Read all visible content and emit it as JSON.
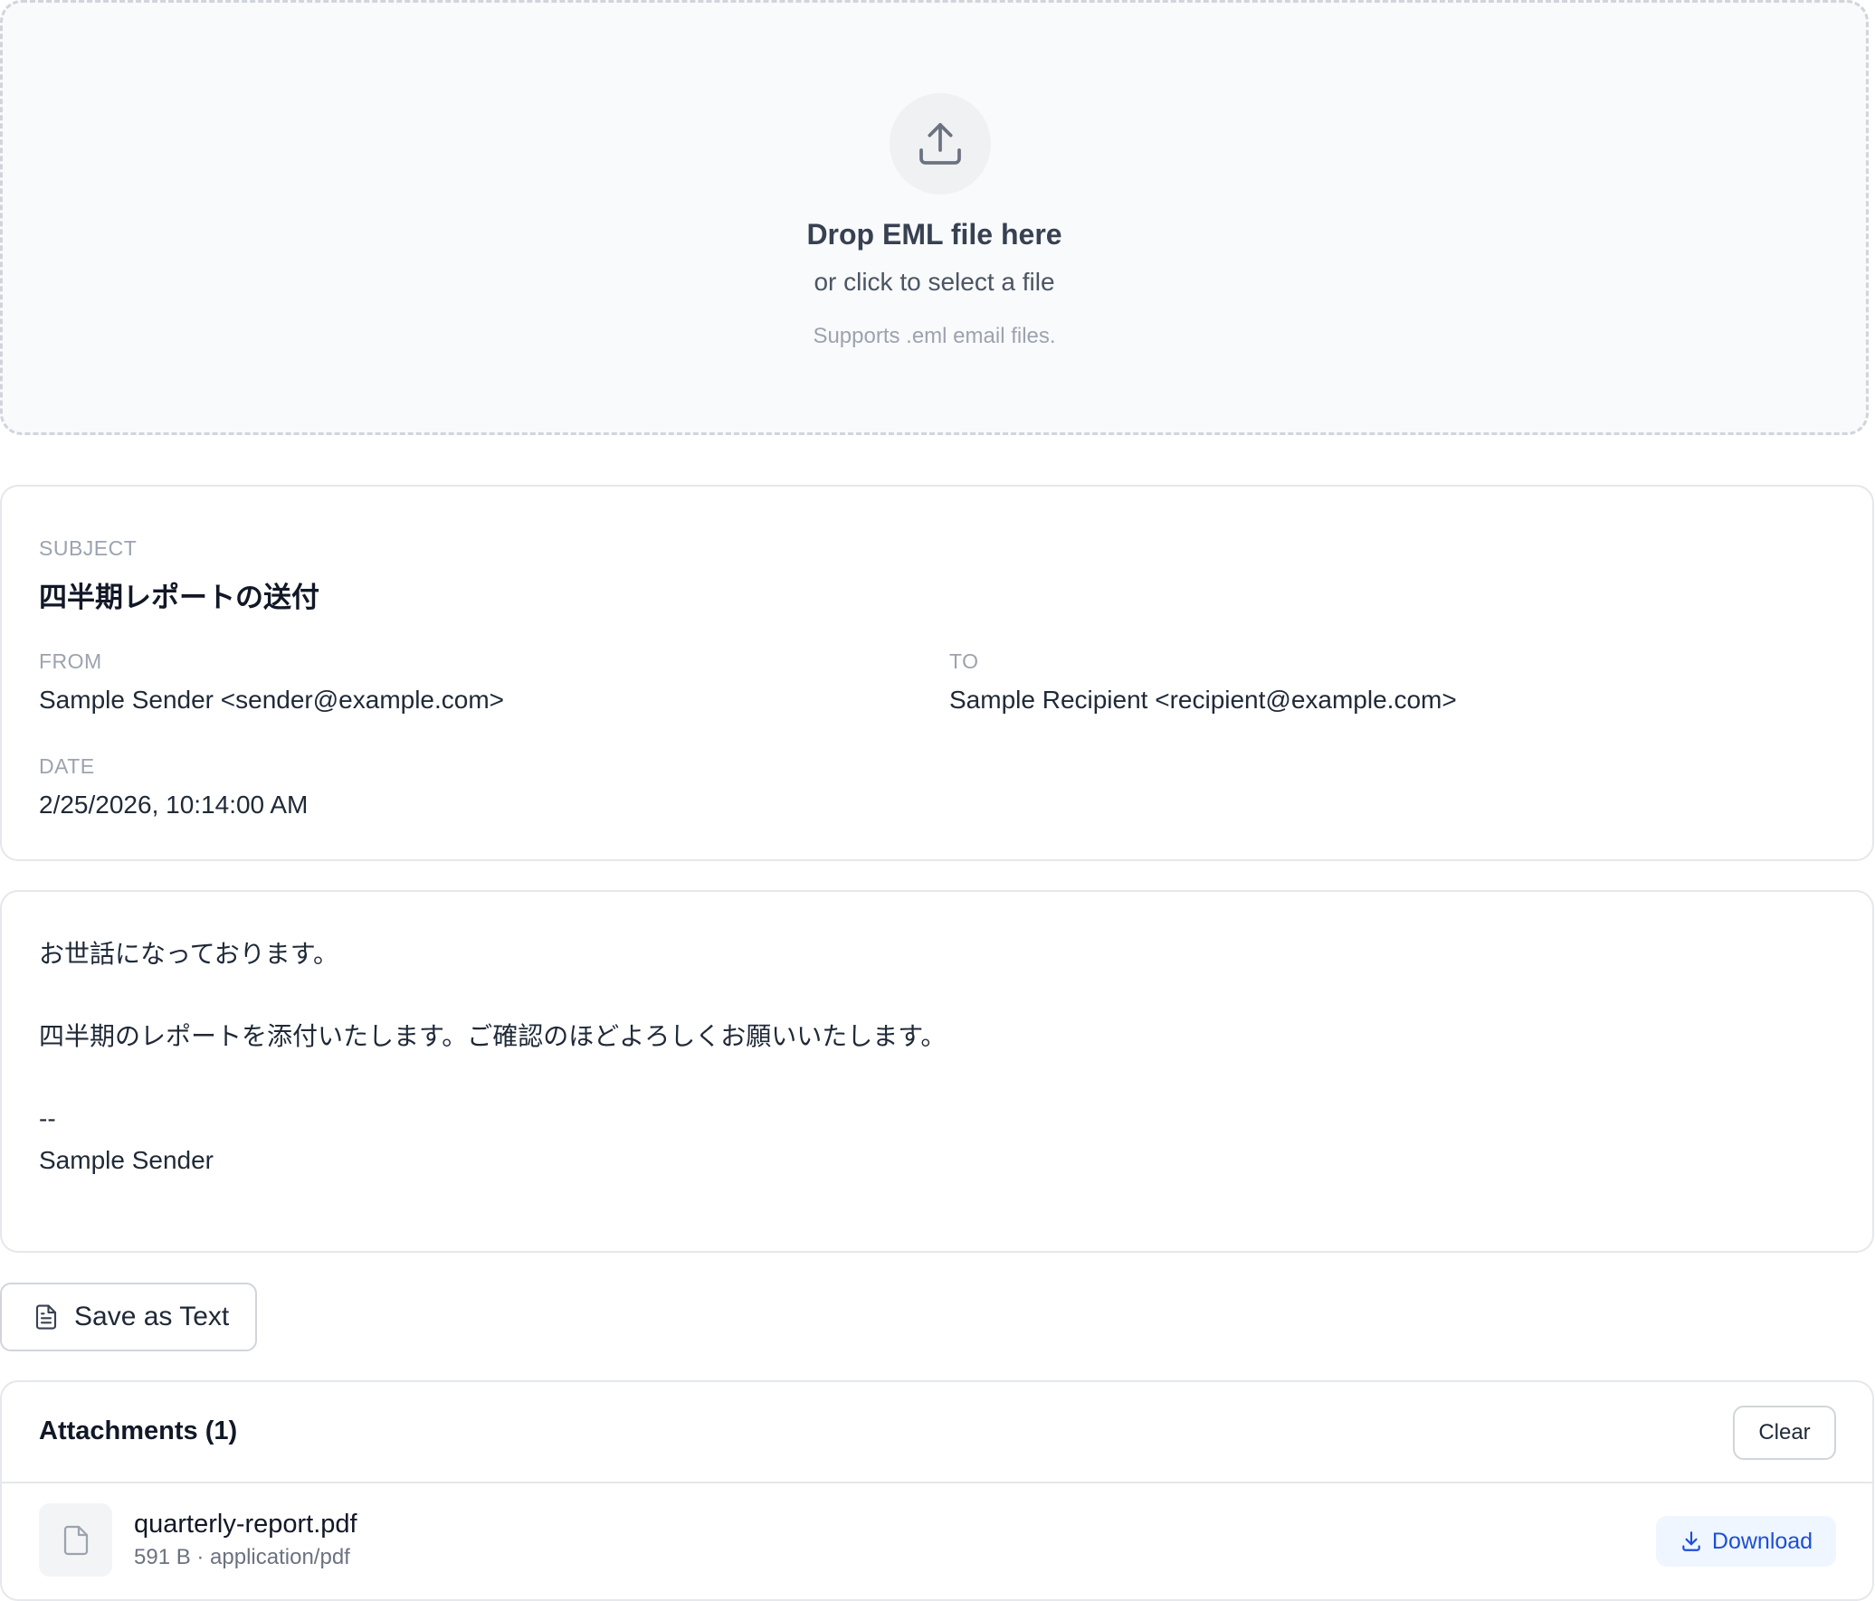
{
  "dropzone": {
    "icon": "upload-icon",
    "title": "Drop EML file here",
    "subtitle": "or click to select a file",
    "hint": "Supports .eml email files."
  },
  "header": {
    "subject_label": "SUBJECT",
    "subject": "四半期レポートの送付",
    "from_label": "FROM",
    "from": "Sample Sender <sender@example.com>",
    "to_label": "TO",
    "to": "Sample Recipient <recipient@example.com>",
    "date_label": "DATE",
    "date": "2/25/2026, 10:14:00 AM"
  },
  "body": {
    "text": "お世話になっております。\n\n四半期のレポートを添付いたします。ご確認のほどよろしくお願いいたします。\n\n--\nSample Sender"
  },
  "actions": {
    "save_icon": "file-text-icon",
    "save_label": "Save as Text"
  },
  "attachments": {
    "title": "Attachments (1)",
    "clear_label": "Clear",
    "items": [
      {
        "icon": "file-icon",
        "name": "quarterly-report.pdf",
        "meta": "591 B · application/pdf",
        "download_icon": "download-icon",
        "download_label": "Download"
      }
    ]
  },
  "colors": {
    "accent": "#1d4ed8",
    "accent_bg": "#eff6ff",
    "border": "#e5e7eb",
    "muted": "#9ca3af"
  }
}
